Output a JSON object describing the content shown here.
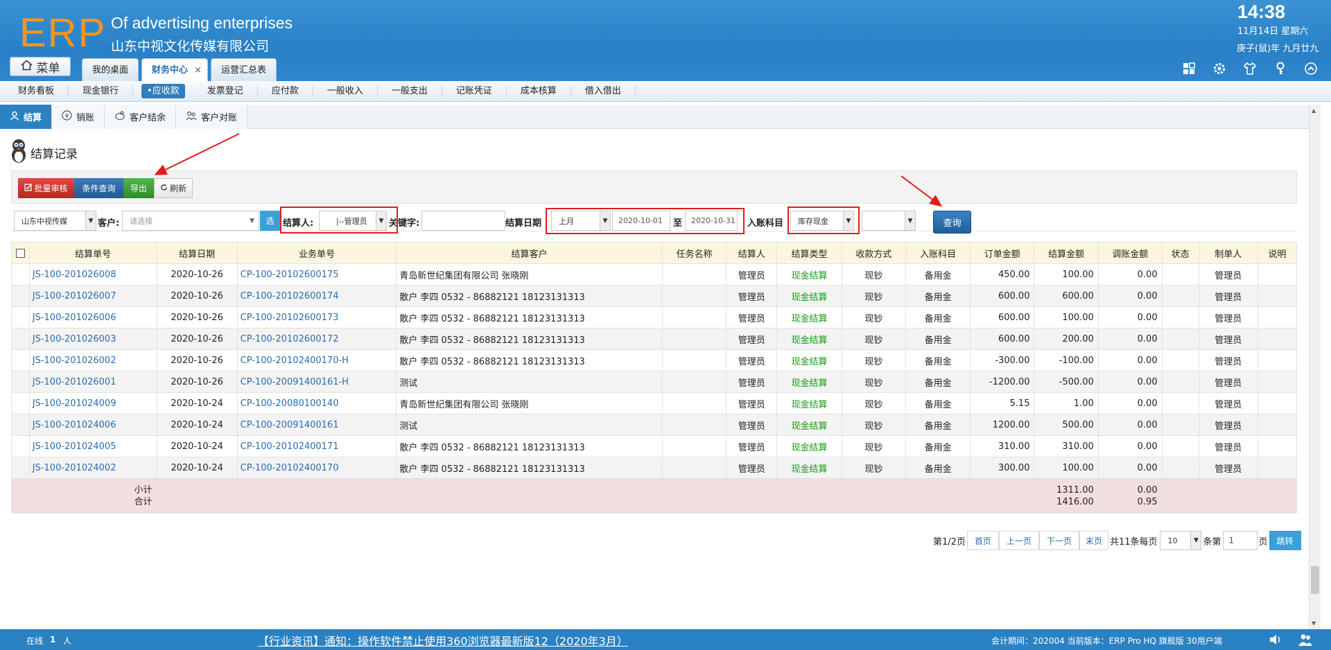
{
  "header": {
    "logo": "ERP",
    "company_en": "Of advertising enterprises",
    "company_cn": "山东中视文化传媒有限公司",
    "time": "14:38",
    "date": "11月14日 星期六",
    "lunar": "庚子(鼠)年 九月廿九",
    "menu_label": "菜单",
    "icons": [
      "grid-icon",
      "gear-icon",
      "shirt-icon",
      "key-icon",
      "up-icon"
    ]
  },
  "tabs": [
    {
      "label": "我的桌面"
    },
    {
      "label": "财务中心",
      "close": "×"
    },
    {
      "label": "运营汇总表"
    }
  ],
  "subnav": [
    "财务看板",
    "现金银行",
    "•应收款",
    "发票登记",
    "应付款",
    "一般收入",
    "一般支出",
    "记账凭证",
    "成本核算",
    "借入借出"
  ],
  "secnav": [
    {
      "label": "结算",
      "icon": "user-icon"
    },
    {
      "label": "销账",
      "icon": "yen-icon"
    },
    {
      "label": "客户结余",
      "icon": "piggy-icon"
    },
    {
      "label": "客户对账",
      "icon": "people-icon"
    }
  ],
  "page_title": "结算记录",
  "toolbar": {
    "batch_audit": "批量审核",
    "cond_query": "条件查询",
    "export": "导出",
    "refresh": "刷新"
  },
  "filter": {
    "company": "山东中视传媒",
    "customer_label": "客户:",
    "customer_placeholder": "请选择",
    "select_btn": "选",
    "settler_label": "结算人:",
    "settler_value": "|--管理员",
    "keyword_label": "关键字:",
    "keyword_value": "",
    "date_label": "结算日期",
    "period": "上月",
    "date_from": "2020-10-01",
    "to": "至",
    "date_to": "2020-10-31",
    "account_label": "入账科目",
    "account_value": "库存现金",
    "account_sub": "",
    "query": "查询"
  },
  "table": {
    "headers": [
      "结算单号",
      "结算日期",
      "业务单号",
      "结算客户",
      "任务名称",
      "结算人",
      "结算类型",
      "收款方式",
      "入账科目",
      "订单金额",
      "结算金额",
      "调账金额",
      "状态",
      "制单人",
      "说明"
    ],
    "rows": [
      [
        "JS-100-201026008",
        "2020-10-26",
        "CP-100-20102600175",
        "青岛新世纪集团有限公司 张晓刚",
        "",
        "管理员",
        "现金结算",
        "现钞",
        "备用金",
        "450.00",
        "100.00",
        "0.00",
        "",
        "管理员",
        ""
      ],
      [
        "JS-100-201026007",
        "2020-10-26",
        "CP-100-20102600174",
        "散户 李四 0532 - 86882121 18123131313",
        "",
        "管理员",
        "现金结算",
        "现钞",
        "备用金",
        "600.00",
        "600.00",
        "0.00",
        "",
        "管理员",
        ""
      ],
      [
        "JS-100-201026006",
        "2020-10-26",
        "CP-100-20102600173",
        "散户 李四 0532 - 86882121 18123131313",
        "",
        "管理员",
        "现金结算",
        "现钞",
        "备用金",
        "600.00",
        "100.00",
        "0.00",
        "",
        "管理员",
        ""
      ],
      [
        "JS-100-201026003",
        "2020-10-26",
        "CP-100-20102600172",
        "散户 李四 0532 - 86882121 18123131313",
        "",
        "管理员",
        "现金结算",
        "现钞",
        "备用金",
        "600.00",
        "200.00",
        "0.00",
        "",
        "管理员",
        ""
      ],
      [
        "JS-100-201026002",
        "2020-10-26",
        "CP-100-20102400170-H",
        "散户 李四 0532 - 86882121 18123131313",
        "",
        "管理员",
        "现金结算",
        "现钞",
        "备用金",
        "-300.00",
        "-100.00",
        "0.00",
        "",
        "管理员",
        ""
      ],
      [
        "JS-100-201026001",
        "2020-10-26",
        "CP-100-20091400161-H",
        "测试",
        "",
        "管理员",
        "现金结算",
        "现钞",
        "备用金",
        "-1200.00",
        "-500.00",
        "0.00",
        "",
        "管理员",
        ""
      ],
      [
        "JS-100-201024009",
        "2020-10-24",
        "CP-100-20080100140",
        "青岛新世纪集团有限公司 张晓刚",
        "",
        "管理员",
        "现金结算",
        "现钞",
        "备用金",
        "5.15",
        "1.00",
        "0.00",
        "",
        "管理员",
        ""
      ],
      [
        "JS-100-201024006",
        "2020-10-24",
        "CP-100-20091400161",
        "测试",
        "",
        "管理员",
        "现金结算",
        "现钞",
        "备用金",
        "1200.00",
        "500.00",
        "0.00",
        "",
        "管理员",
        ""
      ],
      [
        "JS-100-201024005",
        "2020-10-24",
        "CP-100-20102400171",
        "散户 李四 0532 - 86882121 18123131313",
        "",
        "管理员",
        "现金结算",
        "现钞",
        "备用金",
        "310.00",
        "310.00",
        "0.00",
        "",
        "管理员",
        ""
      ],
      [
        "JS-100-201024002",
        "2020-10-24",
        "CP-100-20102400170",
        "散户 李四 0532 - 86882121 18123131313",
        "",
        "管理员",
        "现金结算",
        "现钞",
        "备用金",
        "300.00",
        "100.00",
        "0.00",
        "",
        "管理员",
        ""
      ]
    ],
    "subtotal_label": "小计",
    "total_label": "合计",
    "subtotal_settle": "1311.00",
    "total_settle": "1416.00",
    "subtotal_adjust": "0.00",
    "total_adjust": "0.95"
  },
  "pager": {
    "page_info": "第1/2页",
    "first": "首页",
    "prev": "上一页",
    "next": "下一页",
    "last": "末页",
    "total": "共11条每页",
    "per_page": "10",
    "unit": "条第",
    "page_input": "1",
    "page_unit": "页",
    "go": "跳转"
  },
  "footer": {
    "online": "在线",
    "online_count": "1",
    "online_unit": "人",
    "news": "【行业资讯】通知：操作软件禁止使用360浏览器最新版12（2020年3月）",
    "period": "会计期间：202004 当前版本：ERP Pro HQ 旗舰版 30用户端"
  },
  "colors": {
    "header_blue": "#2b82c3",
    "logo_orange": "#f7941d",
    "link_blue": "#2a6db0",
    "settle_green": "#139b13",
    "summary_pink": "#f2dede",
    "annotation_red": "#e01c1c"
  }
}
